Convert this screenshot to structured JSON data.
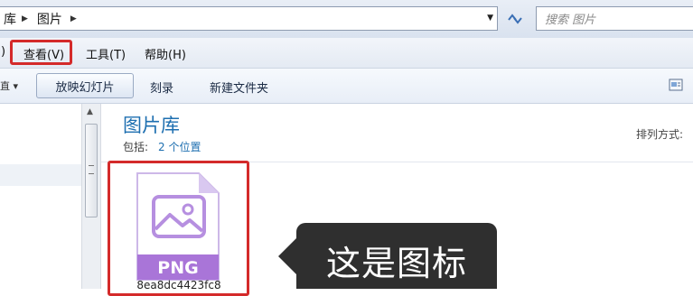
{
  "address": {
    "crumbs": [
      "库",
      "图片"
    ],
    "search_placeholder": "搜索 图片"
  },
  "menu": {
    "partial": ")",
    "items": [
      "查看(V)",
      "工具(T)",
      "帮助(H)"
    ],
    "highlighted": "查看(V)"
  },
  "toolbar": {
    "partial": "直",
    "buttons": [
      "放映幻灯片",
      "刻录",
      "新建文件夹"
    ]
  },
  "library": {
    "title": "图片库",
    "includes_label": "包括:",
    "includes_link": "2 个位置",
    "arrange_label": "排列方式:"
  },
  "file": {
    "type_label": "PNG",
    "name": "8ea8dc4423fc8"
  },
  "callout": {
    "text": "这是图标"
  },
  "colors": {
    "highlight_red": "#d42a2a",
    "title_blue": "#1e6fb0",
    "png_purple": "#a975d8",
    "callout_bg": "#2f2f2f"
  },
  "icons": [
    "chevron-right-icon",
    "chevron-down-icon",
    "refresh-icon",
    "view-options-icon",
    "png-file-icon",
    "image-placeholder-icon"
  ]
}
